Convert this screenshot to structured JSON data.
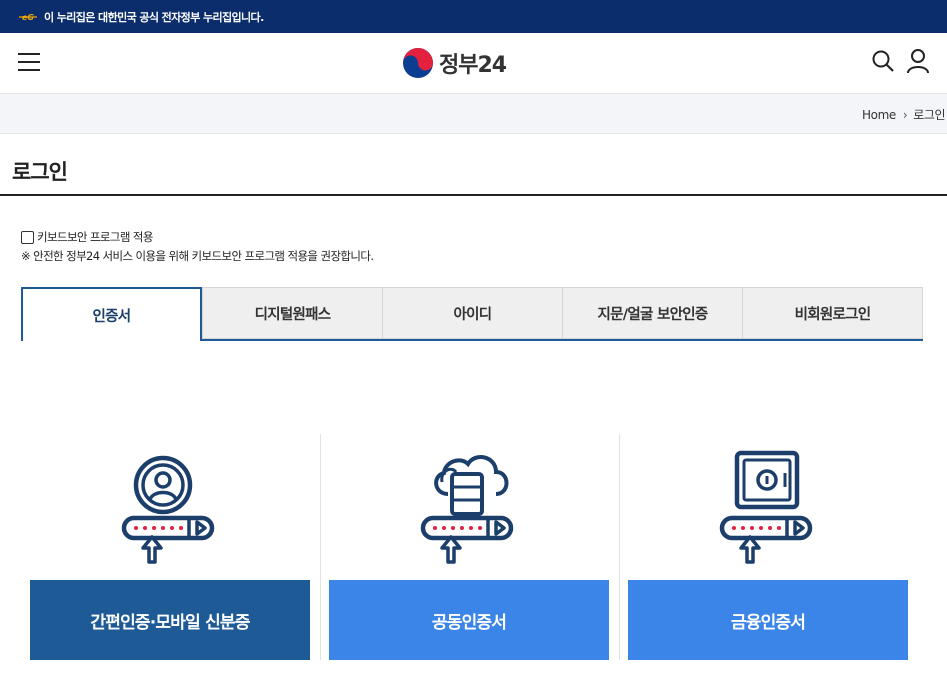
{
  "gov_banner": {
    "text": "이 누리집은 대한민국 공식 전자정부 누리집입니다.",
    "icon": "eg-gov-mark-icon",
    "bg_color": "#0b2d6b"
  },
  "header": {
    "logo_text": "정부24",
    "menu_icon": "hamburger-menu-icon",
    "search_icon": "search-icon",
    "user_icon": "user-icon"
  },
  "breadcrumb": {
    "home": "Home",
    "current": "로그인"
  },
  "page": {
    "title": "로그인"
  },
  "keyboard_security": {
    "checkbox_label": "키보드보안 프로그램 적용",
    "checked": false,
    "note": "※ 안전한 정부24 서비스 이용을 위해 키보드보안 프로그램 적용을 권장합니다."
  },
  "tabs": [
    {
      "label": "인증서",
      "active": true
    },
    {
      "label": "디지털원패스",
      "active": false
    },
    {
      "label": "아이디",
      "active": false
    },
    {
      "label": "지문/얼굴 보안인증",
      "active": false
    },
    {
      "label": "비회원로그인",
      "active": false
    }
  ],
  "login_options": [
    {
      "label": "간편인증·모바일 신분증",
      "icon": "user-profile-password-icon",
      "color": "#1d5a96"
    },
    {
      "label": "공동인증서",
      "icon": "cloud-server-password-icon",
      "color": "#3b85e8"
    },
    {
      "label": "금융인증서",
      "icon": "safe-password-icon",
      "color": "#3b85e8"
    }
  ],
  "colors": {
    "accent": "#1d5a96",
    "button_blue": "#3b85e8",
    "icon_red": "#e3213f"
  }
}
